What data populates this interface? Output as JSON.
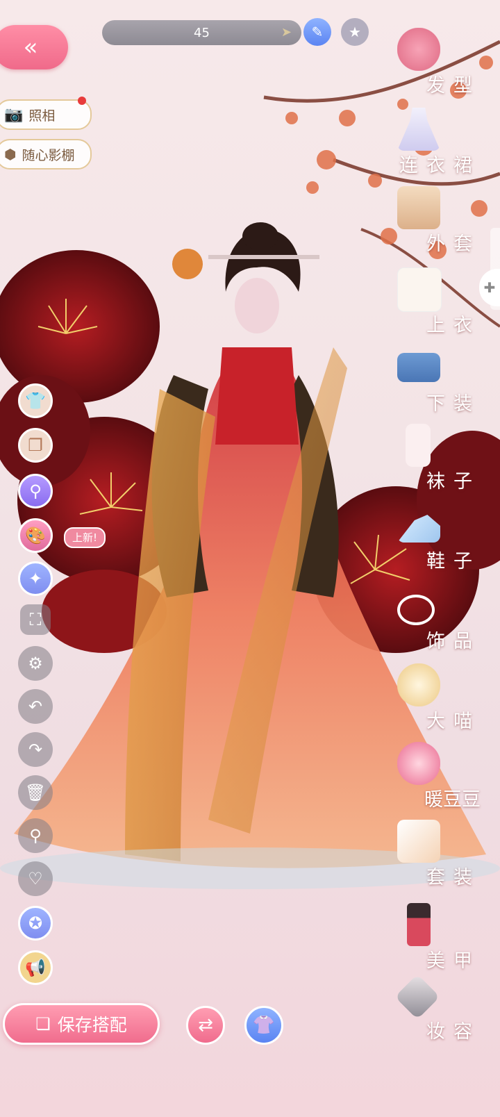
{
  "top_bar": {
    "search_value": "45"
  },
  "left_buttons": {
    "photo_label": "照相",
    "studio_label": "随心影棚"
  },
  "badges": {
    "new_label": "上新!"
  },
  "categories": [
    {
      "label": "发型",
      "icon": "hair-icon"
    },
    {
      "label": "连衣裙",
      "icon": "dress-icon"
    },
    {
      "label": "外套",
      "icon": "coat-icon"
    },
    {
      "label": "上衣",
      "icon": "top-icon"
    },
    {
      "label": "下装",
      "icon": "bottom-icon"
    },
    {
      "label": "袜子",
      "icon": "socks-icon"
    },
    {
      "label": "鞋子",
      "icon": "shoes-icon"
    },
    {
      "label": "饰品",
      "icon": "accessory-icon"
    },
    {
      "label": "大喵",
      "icon": "cat-icon"
    },
    {
      "label": "暖豆豆",
      "icon": "doll-icon"
    },
    {
      "label": "套装",
      "icon": "set-icon"
    },
    {
      "label": "美甲",
      "icon": "nail-polish-icon"
    },
    {
      "label": "妆容",
      "icon": "makeup-icon"
    }
  ],
  "bottom": {
    "save_label": "保存搭配"
  },
  "colors": {
    "accent_pink": "#f06c8d",
    "blue": "#7f8ef0",
    "gold": "#e4c99a"
  }
}
